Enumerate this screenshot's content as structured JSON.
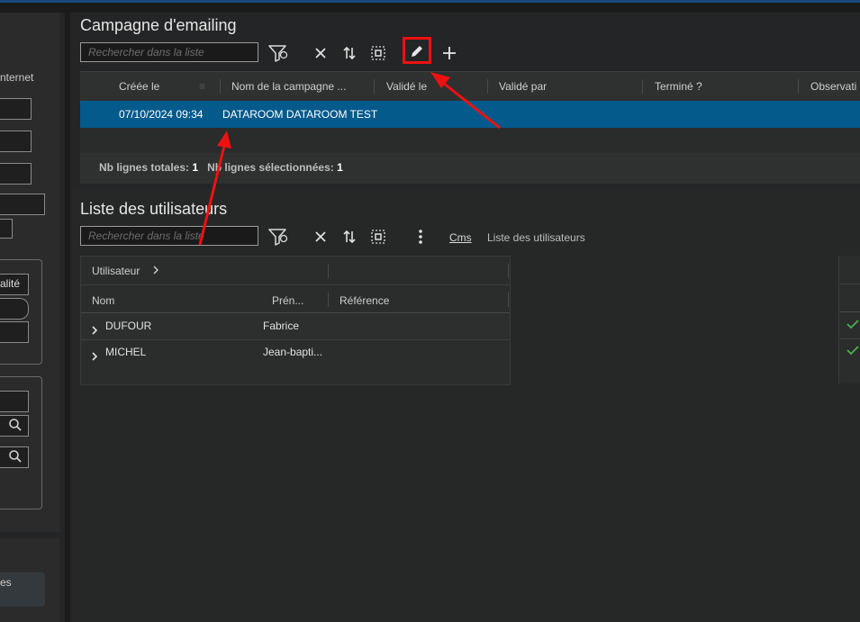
{
  "left_panel": {
    "internet_label": "nternet",
    "qualite_label": "alité",
    "bottom_label": "es"
  },
  "campagne": {
    "title": "Campagne d'emailing",
    "search_placeholder": "Rechercher dans la liste",
    "columns": [
      "Créée le",
      "Nom de la campagne ...",
      "Validé le",
      "Validé par",
      "Terminé ?",
      "Observati"
    ],
    "rows": [
      {
        "created": "07/10/2024 09:34",
        "name": "DATAROOM DATAROOM TEST"
      }
    ],
    "footer": {
      "total_label": "Nb lignes totales:",
      "total_value": "1",
      "selected_label": "Nb lignes sélectionnées:",
      "selected_value": "1"
    }
  },
  "utilisateurs": {
    "title": "Liste des utilisateurs",
    "search_placeholder": "Rechercher dans la liste",
    "link": "Cms",
    "breadcrumb": "Liste des utilisateurs",
    "group_header": "Utilisateur",
    "columns": [
      "Nom",
      "Prén...",
      "Référence"
    ],
    "rows": [
      {
        "nom": "DUFOUR",
        "prenom": "Fabrice"
      },
      {
        "nom": "MICHEL",
        "prenom": "Jean-bapti..."
      }
    ]
  },
  "icons": {
    "filter": "filter-icon",
    "clear": "close-icon",
    "sort": "sort-icon",
    "select_all": "select-all-icon",
    "edit": "pencil-icon",
    "add": "plus-icon",
    "more": "more-vert-icon",
    "search": "search-icon",
    "check": "check-icon",
    "expand": "chevron-right-icon"
  },
  "colors": {
    "selected_row": "#055a8c",
    "highlight": "#ee1111",
    "check": "#4caf50"
  }
}
